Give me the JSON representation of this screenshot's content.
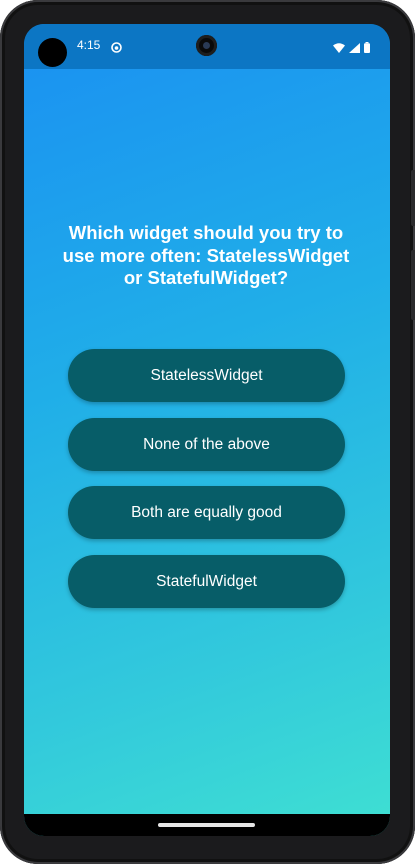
{
  "status_bar": {
    "time": "4:15",
    "notification_icon": "android-debug-icon",
    "icons": [
      "wifi-icon",
      "signal-icon",
      "battery-icon"
    ],
    "background": "#0c76c4"
  },
  "quiz": {
    "question": "Which widget should you try to use more often: StatelessWidget or StatefulWidget?",
    "answers": [
      "StatelessWidget",
      "None of the above",
      "Both are equally good",
      "StatefulWidget"
    ]
  },
  "colors": {
    "gradient_start": "#1a90f2",
    "gradient_end": "#3fe0d2",
    "button_background": "#075d68",
    "text": "#ffffff"
  }
}
